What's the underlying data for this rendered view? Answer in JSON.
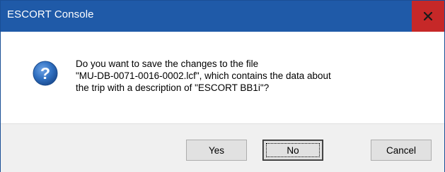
{
  "window": {
    "title": "ESCORT Console"
  },
  "dialog": {
    "icon": "question-icon",
    "message_lines": [
      "Do you want to save the changes to the file",
      "\"MU-DB-0071-0016-0002.lcf\", which contains the data about",
      "the trip with a description of \"ESCORT BB1i\"?"
    ]
  },
  "buttons": {
    "yes_label": "Yes",
    "no_label": "No",
    "cancel_label": "Cancel"
  },
  "colors": {
    "titlebar": "#1f5aa8",
    "close_button": "#c62828",
    "footer": "#f0f0f0",
    "icon_blue": "#2f6fc0"
  }
}
